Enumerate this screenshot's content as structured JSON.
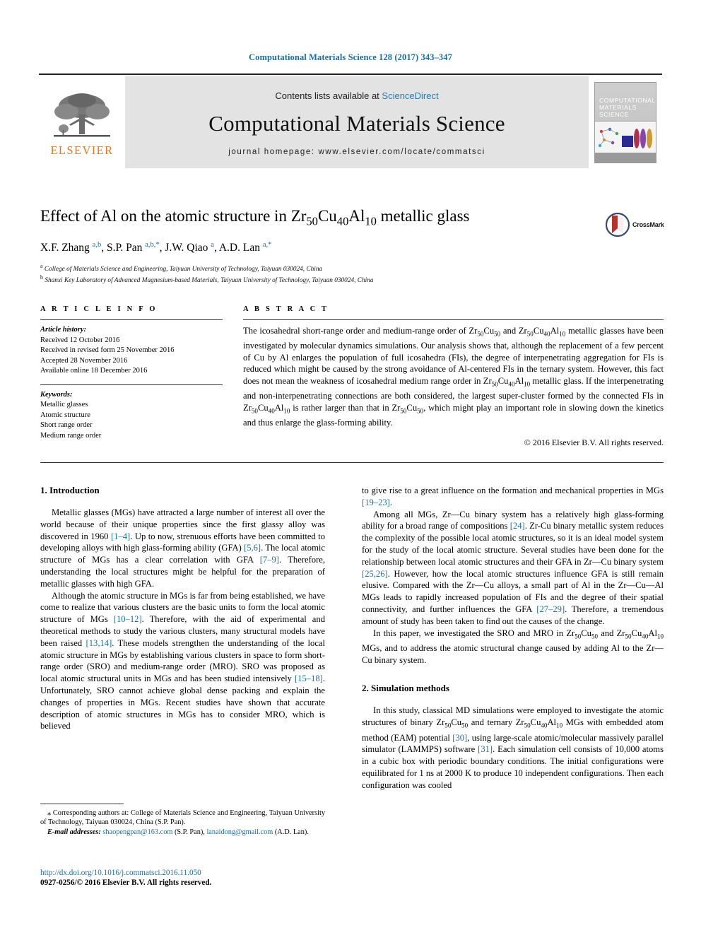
{
  "running_head": "Computational Materials Science 128 (2017) 343–347",
  "masthead": {
    "contents_prefix": "Contents lists available at ",
    "sciencedirect": "ScienceDirect",
    "journal_title": "Computational Materials Science",
    "homepage": "journal homepage: www.elsevier.com/locate/commatsci",
    "publisher_wordmark": "ELSEVIER",
    "publisher_logo_icon": "elsevier-tree-icon",
    "cover_title_lines": "COMPUTATIONAL MATERIALS SCIENCE"
  },
  "title_block": {
    "title_html": "Effect of Al on the atomic structure in Zr<sub>50</sub>Cu<sub>40</sub>Al<sub>10</sub> metallic glass",
    "authors_html": "X.F. Zhang <span class=\"aff\">a,b</span>, S.P. Pan <span class=\"aff\">a,b,*</span>, J.W. Qiao <span class=\"aff\">a</span>, A.D. Lan <span class=\"aff\">a,*</span>",
    "affiliation_a": "College of Materials Science and Engineering, Taiyuan University of Technology, Taiyuan 030024, China",
    "affiliation_b": "Shanxi Key Laboratory of Advanced Magnesium-based Materials, Taiyuan University of Technology, Taiyuan 030024, China",
    "crossmark_label": "CrossMark"
  },
  "article_info": {
    "heading": "A R T I C L E    I N F O",
    "history_label": "Article history:",
    "history": [
      "Received 12 October 2016",
      "Received in revised form 25 November 2016",
      "Accepted 28 November 2016",
      "Available online 18 December 2016"
    ],
    "keywords_label": "Keywords:",
    "keywords": [
      "Metallic glasses",
      "Atomic structure",
      "Short range order",
      "Medium range order"
    ]
  },
  "abstract": {
    "heading": "A B S T R A C T",
    "text_html": "The icosahedral short-range order and medium-range order of Zr<sub>50</sub>Cu<sub>50</sub> and Zr<sub>50</sub>Cu<sub>40</sub>Al<sub>10</sub> metallic glasses have been investigated by molecular dynamics simulations. Our analysis shows that, although the replacement of a few percent of Cu by Al enlarges the population of full icosahedra (FIs), the degree of interpenetrating aggregation for FIs is reduced which might be caused by the strong avoidance of Al-centered FIs in the ternary system. However, this fact does not mean the weakness of icosahedral medium range order in Zr<sub>50</sub>Cu<sub>40</sub>Al<sub>10</sub> metallic glass. If the interpenetrating and non-interpenetrating connections are both considered, the largest super-cluster formed by the connected FIs in Zr<sub>50</sub>Cu<sub>40</sub>Al<sub>10</sub> is rather larger than that in Zr<sub>50</sub>Cu<sub>50</sub>, which might play an important role in slowing down the kinetics and thus enlarge the glass-forming ability.",
    "copyright": "© 2016 Elsevier B.V. All rights reserved."
  },
  "body": {
    "section1_heading": "1. Introduction",
    "section1_p1_html": "Metallic glasses (MGs) have attracted a large number of interest all over the world because of their unique properties since the first glassy alloy was discovered in 1960 <span class=\"ref\">[1–4]</span>. Up to now, strenuous efforts have been committed to developing alloys with high glass-forming ability (GFA) <span class=\"ref\">[5,6]</span>. The local atomic structure of MGs has a clear correlation with GFA <span class=\"ref\">[7–9]</span>. Therefore, understanding the local structures might be helpful for the preparation of metallic glasses with high GFA.",
    "section1_p2_html": "Although the atomic structure in MGs is far from being established, we have come to realize that various clusters are the basic units to form the local atomic structure of MGs <span class=\"ref\">[10–12]</span>. Therefore, with the aid of experimental and theoretical methods to study the various clusters, many structural models have been raised <span class=\"ref\">[13,14]</span>. These models strengthen the understanding of the local atomic structure in MGs by establishing various clusters in space to form short-range order (SRO) and medium-range order (MRO). SRO was proposed as local atomic structural units in MGs and has been studied intensively <span class=\"ref\">[15–18]</span>. Unfortunately, SRO cannot achieve global dense packing and explain the changes of properties in MGs. Recent studies have shown that accurate description of atomic structures in MGs has to consider MRO, which is believed",
    "section1_p3_html": "to give rise to a great influence on the formation and mechanical properties in MGs <span class=\"ref\">[19–23]</span>.",
    "section1_p4_html": "Among all MGs, Zr—Cu binary system has a relatively high glass-forming ability for a broad range of compositions <span class=\"ref\">[24]</span>. Zr-Cu binary metallic system reduces the complexity of the possible local atomic structures, so it is an ideal model system for the study of the local atomic structure. Several studies have been done for the relationship between local atomic structures and their GFA in Zr—Cu binary system <span class=\"ref\">[25,26]</span>. However, how the local atomic structures influence GFA is still remain elusive. Compared with the Zr—Cu alloys, a small part of Al in the Zr—Cu—Al MGs leads to rapidly increased population of FIs and the degree of their spatial connectivity, and further influences the GFA <span class=\"ref\">[27–29]</span>. Therefore, a tremendous amount of study has been taken to find out the causes of the change.",
    "section1_p5_html": "In this paper, we investigated the SRO and MRO in Zr<sub>50</sub>Cu<sub>50</sub> and Zr<sub>50</sub>Cu<sub>40</sub>Al<sub>10</sub> MGs, and to address the atomic structural change caused by adding Al to the Zr—Cu binary system.",
    "section2_heading": "2. Simulation methods",
    "section2_p1_html": "In this study, classical MD simulations were employed to investigate the atomic structures of binary Zr<sub>50</sub>Cu<sub>50</sub> and ternary Zr<sub>50</sub>Cu<sub>40</sub>Al<sub>10</sub> MGs with embedded atom method (EAM) potential <span class=\"ref\">[30]</span>, using large-scale atomic/molecular massively parallel simulator (LAMMPS) software <span class=\"ref\">[31]</span>. Each simulation cell consists of 10,000 atoms in a cubic box with periodic boundary conditions. The initial configurations were equilibrated for 1 ns at 2000 K to produce 10 independent configurations. Then each configuration was cooled"
  },
  "footnotes": {
    "corresponding_html": "<span class=\"lead\">⁎</span> Corresponding authors at: College of Materials Science and Engineering, Taiyuan University of Technology, Taiyuan 030024, China (S.P. Pan).",
    "emails_html": "<span class=\"fn-em\">E-mail addresses:</span> <span class=\"link\">shaopengpan@163.com</span> (S.P. Pan), <span class=\"link\">lanaidong@gmail.com</span> (A.D. Lan).",
    "doi": "http://dx.doi.org/10.1016/j.commatsci.2016.11.050",
    "issn_line": "0927-0256/© 2016 Elsevier B.V. All rights reserved."
  },
  "colors": {
    "link_blue": "#1a6ea8",
    "elsevier_orange": "#E87722",
    "masthead_gray": "#e3e3e3",
    "crossmark_red": "#b5332a"
  }
}
